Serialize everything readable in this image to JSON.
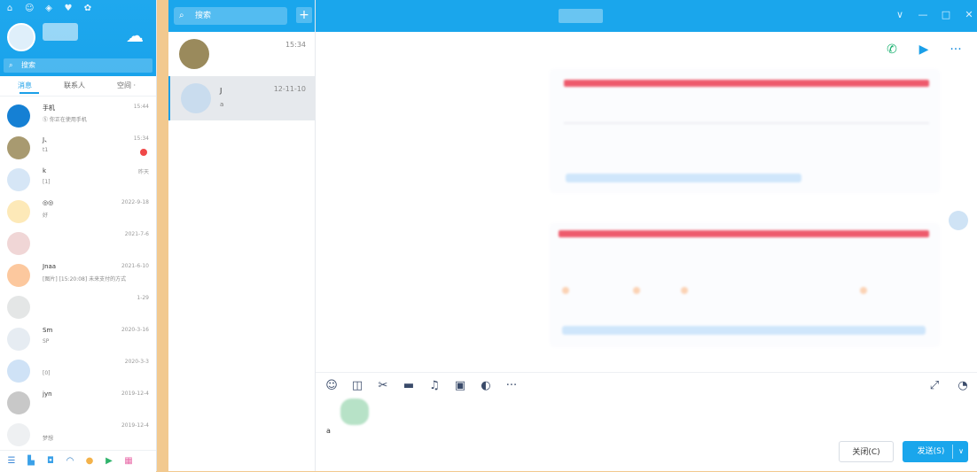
{
  "colors": {
    "accent": "#1aa6ec",
    "badge": "#f04848",
    "gap": "#f2c98f"
  },
  "left": {
    "status_icons": [
      "⌂",
      "☺",
      "◈",
      "♥",
      "✿"
    ],
    "nickname": "",
    "search": {
      "placeholder": "搜索"
    },
    "tabs": [
      {
        "label": "消息",
        "active": true
      },
      {
        "label": "联系人",
        "active": false
      },
      {
        "label": "空间 ·",
        "active": false
      }
    ],
    "chats": [
      {
        "name": "手机",
        "msg": "Ⓢ 你正在使用手机",
        "time": "15:44",
        "avatar_color": "#1580d4",
        "badge": false
      },
      {
        "name": "J、",
        "msg": "t1",
        "time": "15:34",
        "avatar_color": "#a89a70",
        "badge": true
      },
      {
        "name": "k",
        "msg": "[1]",
        "time": "昨天",
        "avatar_color": "#d6e6f6",
        "badge": false
      },
      {
        "name": "◎◎",
        "msg": "好",
        "time": "2022-9-18",
        "avatar_color": "#fde9b8",
        "badge": false
      },
      {
        "name": "",
        "msg": "",
        "time": "2021-7-6",
        "avatar_color": "#f0d6d6",
        "badge": false
      },
      {
        "name": "Jnaa",
        "msg": "[图片] [15:20:08] 未来支付的方式",
        "time": "2021-6-10",
        "avatar_color": "#fcc89e",
        "badge": false
      },
      {
        "name": "",
        "msg": "",
        "time": "1-29",
        "avatar_color": "#e4e6e6",
        "badge": false
      },
      {
        "name": "Sm",
        "msg": "SP",
        "time": "2020-3-16",
        "avatar_color": "#e6ecf2",
        "badge": false
      },
      {
        "name": "",
        "msg": "[0]",
        "time": "2020-3-3",
        "avatar_color": "#cfe2f6",
        "badge": false
      },
      {
        "name": "jyn",
        "msg": "",
        "time": "2019-12-4",
        "avatar_color": "#c8c8c8",
        "badge": false
      },
      {
        "name": "",
        "msg": "梦想",
        "time": "2019-12-4",
        "avatar_color": "#eef0f2",
        "badge": false
      }
    ],
    "bottom_icons": [
      {
        "glyph": "☰",
        "color": "#3a86d6"
      },
      {
        "glyph": "▙",
        "color": "#3aa0e8"
      },
      {
        "glyph": "◘",
        "color": "#3aa0e8"
      },
      {
        "glyph": "◠",
        "color": "#2a7ac0"
      },
      {
        "glyph": "●",
        "color": "#f3b24a"
      },
      {
        "glyph": "▶",
        "color": "#2fb36b"
      },
      {
        "glyph": "▦",
        "color": "#e86aa8"
      }
    ]
  },
  "middle": {
    "search": {
      "placeholder": "搜索"
    },
    "add_label": "+",
    "chats": [
      {
        "name": "",
        "msg": "",
        "time": "15:34",
        "avatar_color": "#9a8a5c",
        "selected": false
      },
      {
        "name": "J",
        "msg": "a",
        "time": "12-11-10",
        "avatar_color": "#c9dcee",
        "selected": true
      }
    ]
  },
  "chat": {
    "title": "",
    "window_controls": [
      "∨",
      "—",
      "□",
      "✕"
    ],
    "actions": [
      {
        "glyph": "✆",
        "color": "#16b06e"
      },
      {
        "glyph": "▶",
        "color": "#1a9fe8"
      },
      {
        "glyph": "···",
        "color": "#1a8ede"
      }
    ],
    "tools": [
      "☺",
      "◫",
      "✂",
      "▬",
      "♫",
      "▣",
      "◐",
      "···"
    ],
    "draft_text": "a",
    "close_label": "关闭(C)",
    "send_label": "发送(S)",
    "send_arrow": "∨"
  }
}
